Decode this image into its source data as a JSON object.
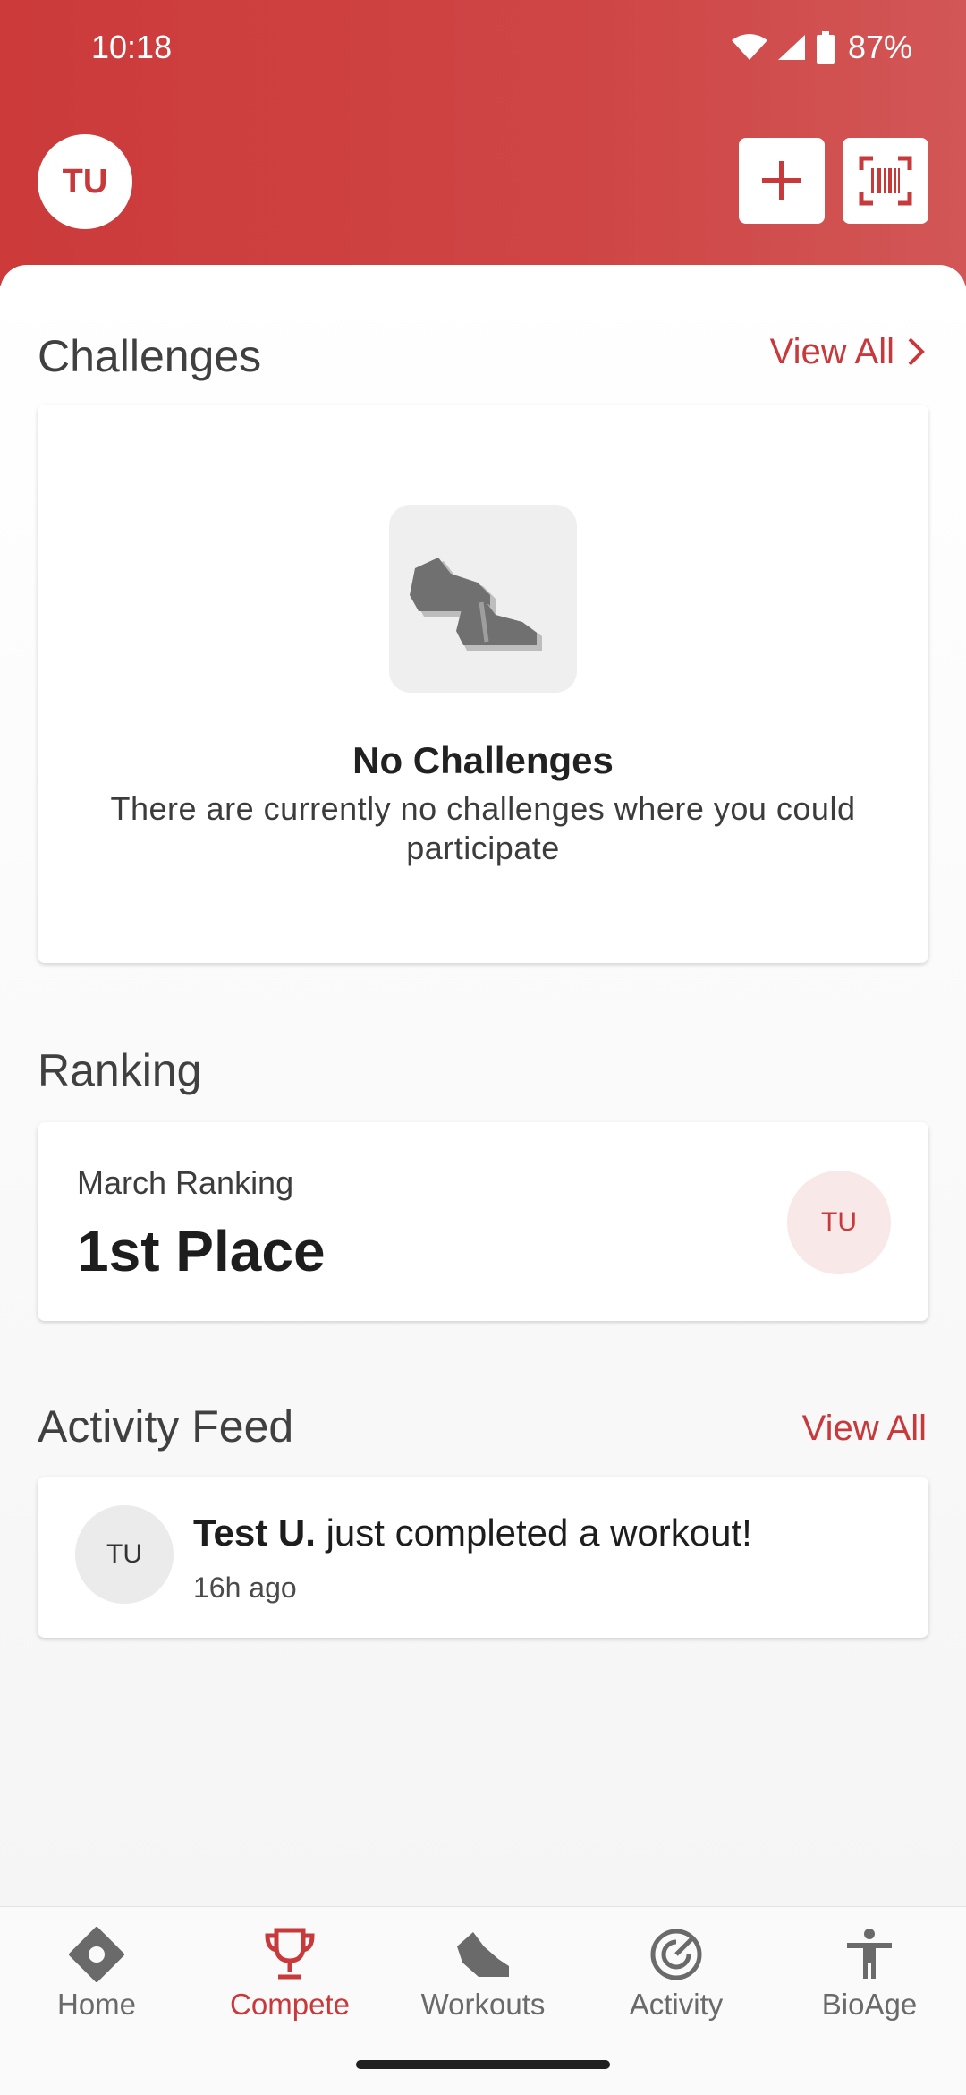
{
  "status_bar": {
    "time": "10:18",
    "battery": "87%"
  },
  "header": {
    "avatar_initials": "TU"
  },
  "challenges": {
    "title": "Challenges",
    "view_all": "View All",
    "empty_title": "No Challenges",
    "empty_description": "There are currently no challenges where you could participate"
  },
  "ranking": {
    "title": "Ranking",
    "label": "March Ranking",
    "value": "1st Place",
    "avatar_initials": "TU"
  },
  "activity_feed": {
    "title": "Activity Feed",
    "view_all": "View All",
    "items": [
      {
        "avatar_initials": "TU",
        "name": "Test U.",
        "message": " just completed a workout!",
        "time": "16h ago"
      }
    ]
  },
  "bottom_nav": {
    "items": [
      {
        "label": "Home",
        "icon": "home-icon"
      },
      {
        "label": "Compete",
        "icon": "trophy-icon"
      },
      {
        "label": "Workouts",
        "icon": "shoe-icon"
      },
      {
        "label": "Activity",
        "icon": "activity-gauge-icon"
      },
      {
        "label": "BioAge",
        "icon": "person-icon"
      }
    ],
    "active_index": 1
  },
  "colors": {
    "accent": "#c8393b",
    "header_bg": "#cd4040"
  }
}
